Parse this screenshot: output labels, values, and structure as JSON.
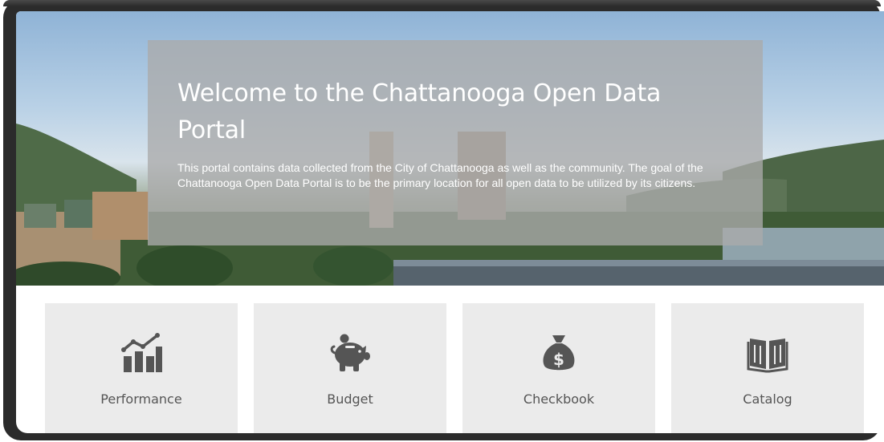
{
  "hero": {
    "title": "Welcome to the Chattanooga Open Data Portal",
    "description": "This portal contains data collected from the City of Chattanooga as well as the community. The goal of the Chattanooga Open Data Portal is to be the primary location for all open data to be utilized by its citizens."
  },
  "tiles": [
    {
      "label": "Performance",
      "icon": "chart-increasing-icon"
    },
    {
      "label": "Budget",
      "icon": "piggy-bank-icon"
    },
    {
      "label": "Checkbook",
      "icon": "money-bag-icon"
    },
    {
      "label": "Catalog",
      "icon": "open-book-icon"
    }
  ],
  "colors": {
    "tile_background": "#ebebeb",
    "tile_icon": "#555555",
    "overlay": "#aaaaaa"
  }
}
